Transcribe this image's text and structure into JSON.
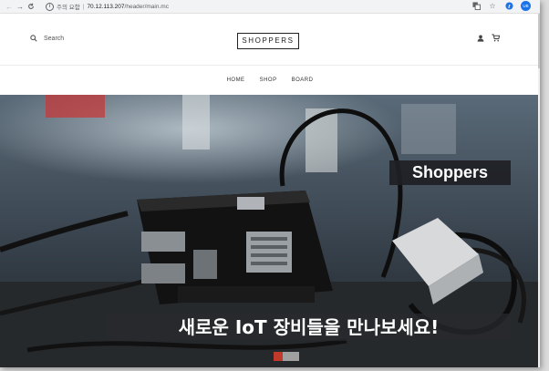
{
  "browser": {
    "back_icon": "arrow-left-icon",
    "forward_icon": "arrow-right-icon",
    "reload_icon": "reload-icon",
    "security_label": "주의 요함",
    "url_host": "70.12.113.207",
    "url_path": "/header/main.mc",
    "profile_initials": "UB"
  },
  "header": {
    "search_label": "Search",
    "logo": "SHOPPERS"
  },
  "nav": {
    "items": [
      "HOME",
      "SHOP",
      "BOARD"
    ]
  },
  "hero": {
    "title": "Shoppers",
    "caption": "새로운 IoT 장비들을 만나보세요!"
  },
  "colors": {
    "accent_profile": "#1a73e8",
    "hero_overlay": "#1e2024"
  }
}
